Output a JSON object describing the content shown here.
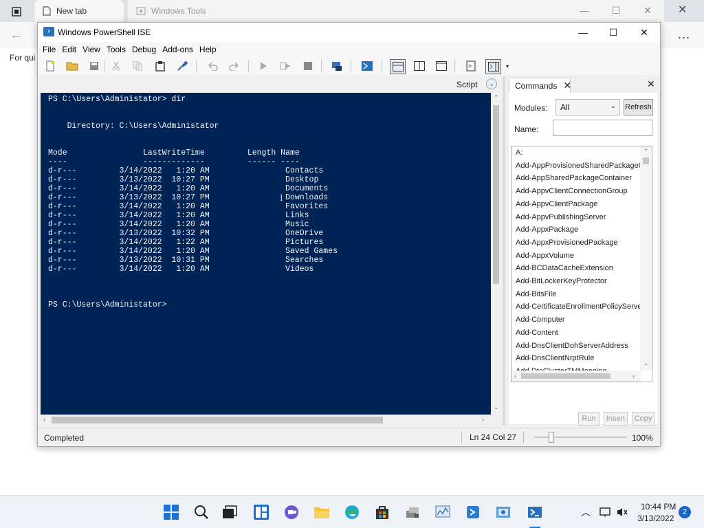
{
  "browser": {
    "tabs": [
      {
        "label": "New tab"
      },
      {
        "label": "Windows Tools"
      }
    ],
    "favorites_hint": "For qui",
    "more_label": "..."
  },
  "ise": {
    "title": "Windows PowerShell ISE",
    "menu": [
      "File",
      "Edit",
      "View",
      "Tools",
      "Debug",
      "Add-ons",
      "Help"
    ],
    "script_label": "Script",
    "console_lines": [
      "PS C:\\Users\\Administator> dir",
      "",
      "",
      "    Directory: C:\\Users\\Administator",
      "",
      "",
      "Mode                LastWriteTime         Length Name",
      "----                -------------         ------ ----",
      "d-r---         3/14/2022   1:20 AM                Contacts",
      "d-r---         3/13/2022  10:27 PM                Desktop",
      "d-r---         3/14/2022   1:20 AM                Documents",
      "d-r---         3/13/2022  10:27 PM                Downloads",
      "d-r---         3/14/2022   1:20 AM                Favorites",
      "d-r---         3/14/2022   1:20 AM                Links",
      "d-r---         3/14/2022   1:20 AM                Music",
      "d-r---         3/13/2022  10:32 PM                OneDrive",
      "d-r---         3/14/2022   1:22 AM                Pictures",
      "d-r---         3/14/2022   1:20 AM                Saved Games",
      "d-r---         3/13/2022  10:31 PM                Searches",
      "d-r---         3/14/2022   1:20 AM                Videos",
      "",
      "",
      "",
      "PS C:\\Users\\Administator> "
    ],
    "status": "Completed",
    "position": "Ln 24  Col 27",
    "zoom": "100%"
  },
  "commands": {
    "tab_label": "Commands",
    "modules_label": "Modules:",
    "modules_value": "All",
    "refresh_label": "Refresh",
    "name_label": "Name:",
    "name_value": "",
    "items": [
      "A:",
      "Add-AppProvisionedSharedPackageC",
      "Add-AppSharedPackageContainer",
      "Add-AppvClientConnectionGroup",
      "Add-AppvClientPackage",
      "Add-AppvPublishingServer",
      "Add-AppxPackage",
      "Add-AppxProvisionedPackage",
      "Add-AppxVolume",
      "Add-BCDataCacheExtension",
      "Add-BitLockerKeyProtector",
      "Add-BitsFile",
      "Add-CertificateEnrollmentPolicyServe",
      "Add-Computer",
      "Add-Content",
      "Add-DnsClientDohServerAddress",
      "Add-DnsClientNrptRule",
      "Add-DtcClusterTMMapping"
    ],
    "run_label": "Run",
    "insert_label": "Insert",
    "copy_label": "Copy"
  },
  "taskbar": {
    "time": "10:44 PM",
    "date": "3/13/2022",
    "notification_count": "2"
  },
  "colors": {
    "console_bg": "#012456",
    "console_fg": "#F5F5F5",
    "accent": "#2577D8"
  }
}
